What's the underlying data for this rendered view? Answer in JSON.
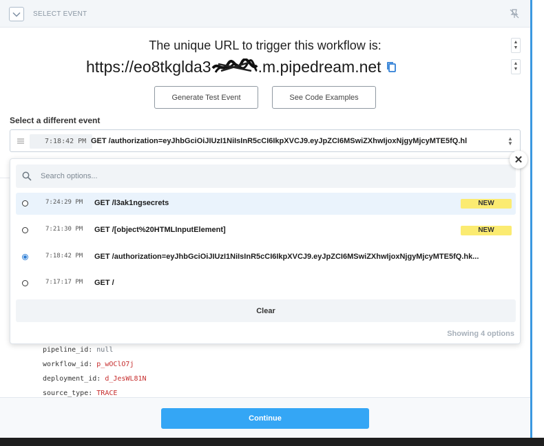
{
  "header": {
    "title": "SELECT EVENT"
  },
  "trigger": {
    "intro": "The unique URL to trigger this workflow is:",
    "url_prefix": "https://eo8tkglda3",
    "url_suffix": ".m.pipedream.net"
  },
  "buttons": {
    "generate": "Generate Test Event",
    "examples": "See Code Examples",
    "continue": "Continue",
    "clear": "Clear"
  },
  "select": {
    "label": "Select a different event",
    "time": "7:18:42 PM",
    "value": "GET /authorization=eyJhbGciOiJIUzI1NiIsInR5cCI6IkpXVCJ9.eyJpZCI6MSwiZXhwIjoxNjgyMjcyMTE5fQ.hl"
  },
  "dropdown": {
    "search_placeholder": "Search options...",
    "options": [
      {
        "time": "7:24:29 PM",
        "label": "GET /l3ak1ngsecrets",
        "badge": "NEW"
      },
      {
        "time": "7:21:30 PM",
        "label": "GET /[object%20HTMLInputElement]",
        "badge": "NEW"
      },
      {
        "time": "7:18:42 PM",
        "label": "GET /authorization=eyJhbGciOiJIUzI1NiIsInR5cCI6IkpXVCJ9.eyJpZCI6MSwiZXhwIjoxNjgyMjcyMTE5fQ.hk...",
        "badge": ""
      },
      {
        "time": "7:17:17 PM",
        "label": "GET /",
        "badge": ""
      }
    ],
    "showing": "Showing 4 options"
  },
  "code": {
    "pipeline_key": "pipeline_id",
    "pipeline_val": "null",
    "workflow_key": "workflow_id",
    "workflow_val": "p_wOClO7j",
    "deployment_key": "deployment_id",
    "deployment_val": "d_JesWL81N",
    "source_key": "source_type",
    "source_val": "TRACE"
  },
  "colors": {
    "accent": "#34a6f5",
    "badge": "#fbeb71",
    "selected_radio": "#2f7fd6",
    "code_value": "#c62c2c"
  }
}
